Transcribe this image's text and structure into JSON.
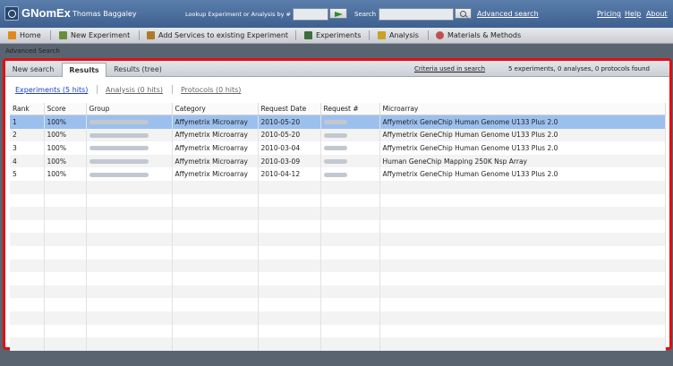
{
  "header": {
    "app_title": "GNomEx",
    "user_name": "Thomas Baggaley",
    "lookup_label": "Lookup Experiment or Analysis by #",
    "lookup_value": "",
    "search_label": "Search",
    "search_value": "",
    "advanced_search_link": "Advanced search",
    "links": [
      "Pricing",
      "Help",
      "About"
    ]
  },
  "nav": {
    "items": [
      {
        "label": "Home",
        "icon": "home-icon",
        "color": "#e08a1e"
      },
      {
        "label": "New Experiment",
        "icon": "flask-icon",
        "color": "#6c8d3a"
      },
      {
        "label": "Add Services to existing Experiment",
        "icon": "flask-plus-icon",
        "color": "#b07a2a"
      },
      {
        "label": "Experiments",
        "icon": "beaker-icon",
        "color": "#3b6e3b"
      },
      {
        "label": "Analysis",
        "icon": "chart-icon",
        "color": "#c9a227"
      },
      {
        "label": "Materials & Methods",
        "icon": "palette-icon",
        "color": "#c0504d"
      }
    ]
  },
  "page": {
    "title": "Advanced Search"
  },
  "tabs": [
    "New search",
    "Results",
    "Results (tree)"
  ],
  "active_tab": "Results",
  "criteria_link": "Criteria used in search",
  "summary_text": "5 experiments, 0 analyses, 0 protocols found",
  "result_tabs": [
    {
      "label": "Experiments (5 hits)",
      "color": "#1a3fc8"
    },
    {
      "label": "Analysis (0 hits)",
      "color": "#666666"
    },
    {
      "label": "Protocols (0 hits)",
      "color": "#666666"
    }
  ],
  "table": {
    "columns": [
      "Rank",
      "Score",
      "Group",
      "Category",
      "Request Date",
      "Request #",
      "Microarray"
    ],
    "rows": [
      {
        "rank": "1",
        "score": "100%",
        "category": "Affymetrix Microarray",
        "date": "2010-05-20",
        "microarray": "Affymetrix GeneChip Human Genome U133 Plus 2.0",
        "selected": true
      },
      {
        "rank": "2",
        "score": "100%",
        "category": "Affymetrix Microarray",
        "date": "2010-05-20",
        "microarray": "Affymetrix GeneChip Human Genome U133 Plus 2.0",
        "selected": false
      },
      {
        "rank": "3",
        "score": "100%",
        "category": "Affymetrix Microarray",
        "date": "2010-03-04",
        "microarray": "Affymetrix GeneChip Human Genome U133 Plus 2.0",
        "selected": false
      },
      {
        "rank": "4",
        "score": "100%",
        "category": "Affymetrix Microarray",
        "date": "2010-03-09",
        "microarray": "Human GeneChip Mapping 250K Nsp Array",
        "selected": false
      },
      {
        "rank": "5",
        "score": "100%",
        "category": "Affymetrix Microarray",
        "date": "2010-04-12",
        "microarray": "Affymetrix GeneChip Human Genome U133 Plus 2.0",
        "selected": false
      }
    ],
    "empty_rows": 13
  },
  "colors": {
    "highlight_border": "#e01010",
    "selected_row": "#9cc0ee",
    "header_bar": "#4a6e9e"
  }
}
